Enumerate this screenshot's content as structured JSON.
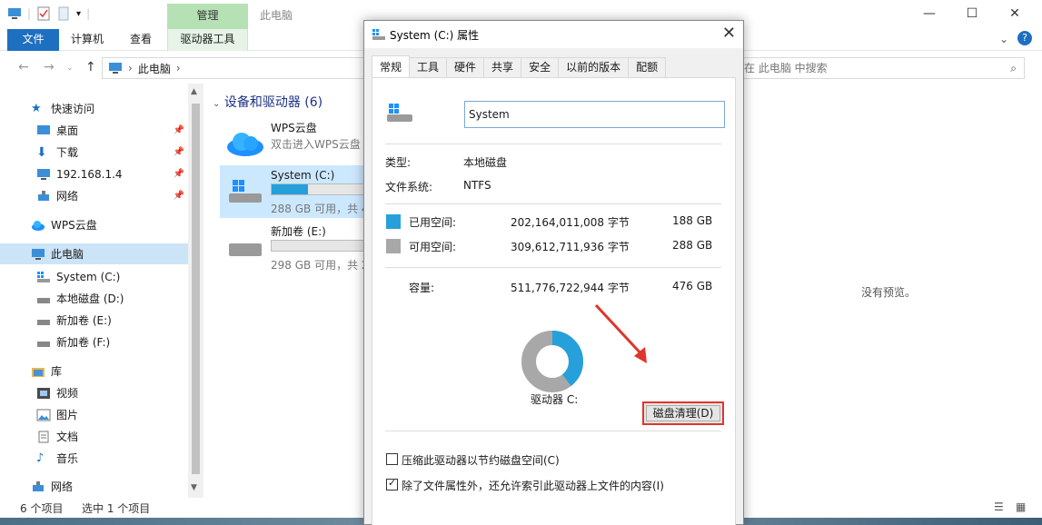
{
  "explorer": {
    "title": "此电脑",
    "context_tab": "管理",
    "ribbon_tabs": [
      "文件",
      "计算机",
      "查看",
      "驱动器工具"
    ],
    "address": [
      "此电脑"
    ],
    "search_placeholder": "在 此电脑 中搜索",
    "nav": {
      "quick_access": "快速访问",
      "desktop": "桌面",
      "downloads": "下载",
      "ip": "192.168.1.4",
      "network_pinned": "网络",
      "wps": "WPS云盘",
      "this_pc": "此电脑",
      "system_c": "System (C:)",
      "local_d": "本地磁盘 (D:)",
      "vol_e": "新加卷 (E:)",
      "vol_f": "新加卷 (F:)",
      "library": "库",
      "video": "视频",
      "pictures": "图片",
      "docs": "文档",
      "music": "音乐",
      "network": "网络"
    },
    "group_header": "设备和驱动器 (6)",
    "tiles": [
      {
        "name": "WPS云盘",
        "sub": "双击进入WPS云盘"
      },
      {
        "name": "System (C:)",
        "cap": "288 GB 可用，共 4",
        "used_fraction": 0.39
      },
      {
        "name": "新加卷 (E:)",
        "cap": "298 GB 可用，共 2",
        "used_fraction": 0.0
      }
    ],
    "preview": "没有预览。",
    "status": {
      "items": "6 个项目",
      "selected": "选中 1 个项目"
    }
  },
  "dialog": {
    "title": "System (C:) 属性",
    "tabs": [
      "常规",
      "工具",
      "硬件",
      "共享",
      "安全",
      "以前的版本",
      "配额"
    ],
    "drive_name": "System",
    "type_label": "类型:",
    "type_value": "本地磁盘",
    "fs_label": "文件系统:",
    "fs_value": "NTFS",
    "used_label": "已用空间:",
    "used_bytes": "202,164,011,008 字节",
    "used_gb": "188 GB",
    "free_label": "可用空间:",
    "free_bytes": "309,612,711,936 字节",
    "free_gb": "288 GB",
    "cap_label": "容量:",
    "cap_bytes": "511,776,722,944 字节",
    "cap_gb": "476 GB",
    "drive_label": "驱动器 C:",
    "cleanup": "磁盘清理(D)",
    "compress": "压缩此驱动器以节约磁盘空间(C)",
    "index": "除了文件属性外，还允许索引此驱动器上文件的内容(I)",
    "used_fraction": 0.395,
    "colors": {
      "used": "#26a0da",
      "free": "#a8a8a8",
      "highlight": "#e0352b"
    }
  }
}
